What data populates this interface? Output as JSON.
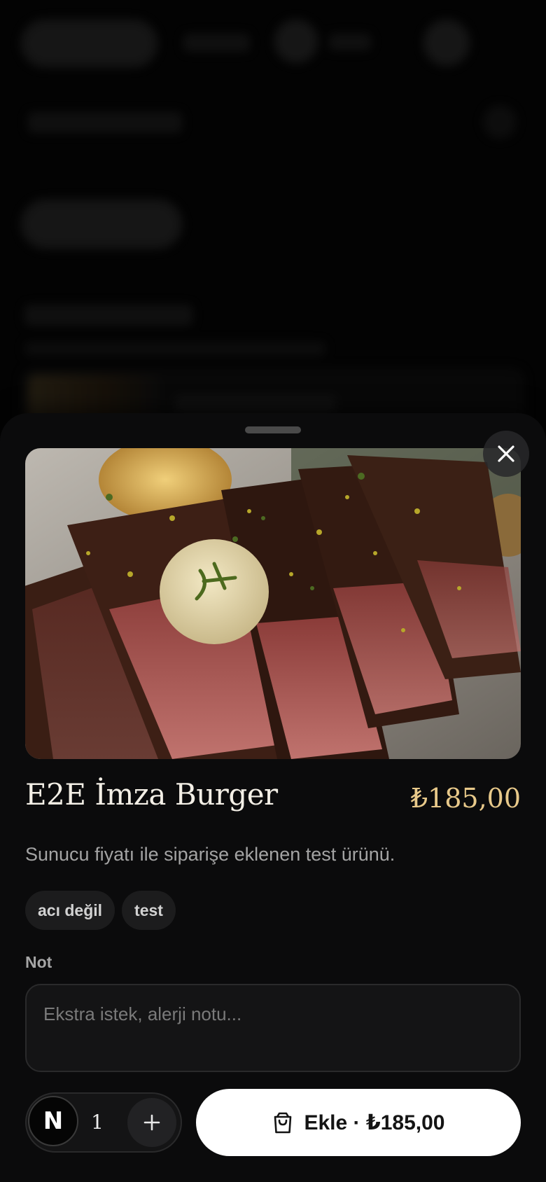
{
  "product": {
    "name": "E2E İmza Burger",
    "price": "₺185,00",
    "description": "Sunucu fiyatı ile siparişe eklenen test ürünü.",
    "tags": [
      "acı değil",
      "test"
    ],
    "image_icon": "steak-photo"
  },
  "note": {
    "label": "Not",
    "placeholder": "Ekstra istek, alerji notu..."
  },
  "quantity": {
    "value": "1",
    "decrement_glyph": "N",
    "increment_icon": "plus-icon"
  },
  "add_button": {
    "label": "Ekle · ₺185,00",
    "icon": "shopping-bag-icon"
  },
  "sheet": {
    "close_icon": "close-icon"
  },
  "colors": {
    "accent_price": "#e8c98a",
    "sheet_bg": "#0b0b0c",
    "button_bg": "#ffffff"
  }
}
